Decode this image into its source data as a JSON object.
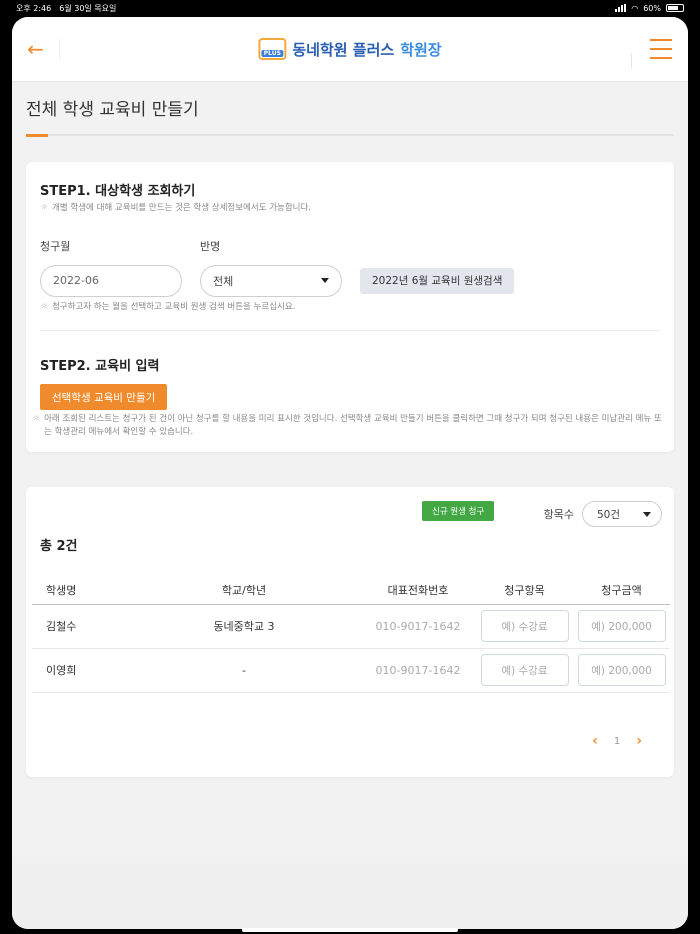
{
  "status_bar": {
    "time": "오후 2:46",
    "date": "6월 30일 목요일",
    "battery": "60%"
  },
  "header": {
    "logo_brand": "동네학원 플러스",
    "logo_suffix": "학원장",
    "logo_badge": "PLUS"
  },
  "page": {
    "title": "전체 학생 교육비 만들기"
  },
  "step1": {
    "title": "STEP1. 대상학생 조회하기",
    "hint": "개별 학생에 대해 교육비를 만드는 것은 학생 상세정보에서도 가능합니다.",
    "billing_month_label": "청구월",
    "billing_month_value": "2022-06",
    "class_label": "반명",
    "class_value": "전체",
    "search_button": "2022년 6월 교육비 원생검색",
    "search_hint": "청구하고자 하는 월을 선택하고 교육비 원생 검색 버튼을 누르십시요."
  },
  "step2": {
    "title": "STEP2. 교육비 입력",
    "create_button": "선택학생 교육비 만들기",
    "hint": "아래 조회된 리스트는 청구가 된 건이 아닌 청구를 할 내용을 미리 표시한 것입니다. 선택학생 교육비 만들기 버튼을 클릭하면 그때 청구가 되며 청구된 내용은 미납관리 메뉴 또는 학생관리 메뉴에서 확인할 수 있습니다."
  },
  "list": {
    "new_bill_button": "신규 원생 청구",
    "per_page_label": "항목수",
    "per_page_value": "50건",
    "total": "총 2건",
    "columns": [
      "학생명",
      "학교/학년",
      "대표전화번호",
      "청구항목",
      "청구금액"
    ],
    "rows": [
      {
        "name": "김철수",
        "school": "동네중학교 3",
        "phone": "010-9017-1642",
        "item_placeholder": "예) 수강료",
        "amount_placeholder": "예) 200,000"
      },
      {
        "name": "이영희",
        "school": "-",
        "phone": "010-9017-1642",
        "item_placeholder": "예) 수강료",
        "amount_placeholder": "예) 200,000"
      }
    ],
    "pagination": {
      "current_page": "1",
      "prev_icon": "chevron-left-icon",
      "next_icon": "chevron-right-icon"
    }
  },
  "colors": {
    "accent": "#ef8b2c",
    "green": "#43a743",
    "brand_blue": "#2a5fb3"
  }
}
